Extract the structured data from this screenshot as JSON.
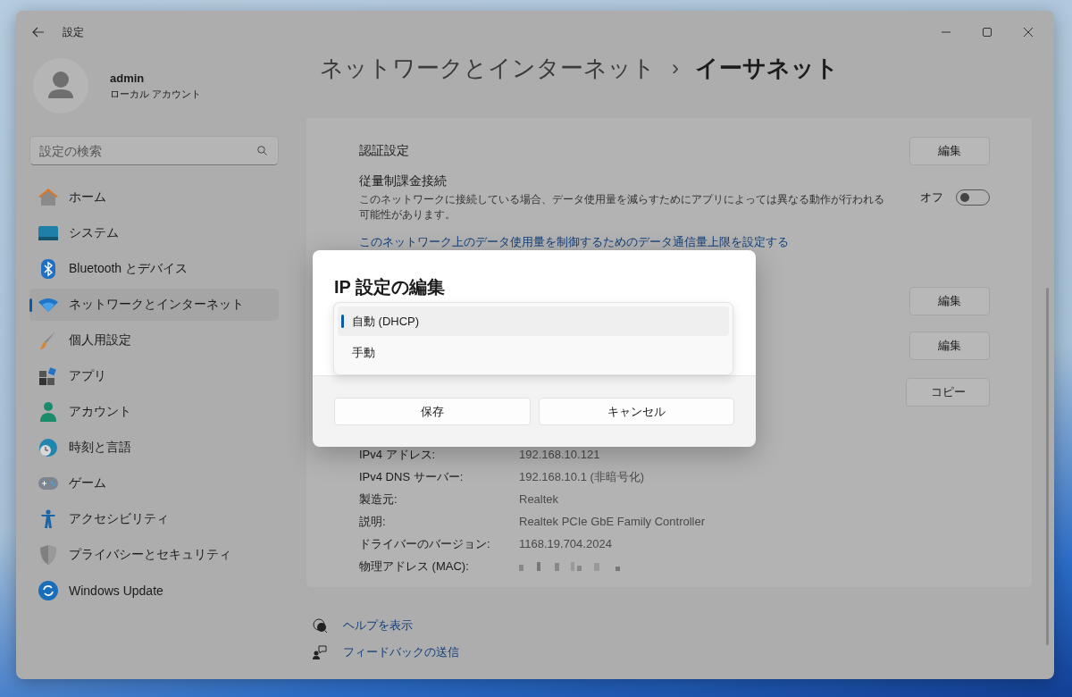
{
  "window": {
    "title": "設定"
  },
  "account": {
    "name": "admin",
    "type": "ローカル アカウント"
  },
  "search": {
    "placeholder": "設定の検索"
  },
  "sidebar": {
    "items": [
      {
        "label": "ホーム",
        "selected": false
      },
      {
        "label": "システム",
        "selected": false
      },
      {
        "label": "Bluetooth とデバイス",
        "selected": false
      },
      {
        "label": "ネットワークとインターネット",
        "selected": true
      },
      {
        "label": "個人用設定",
        "selected": false
      },
      {
        "label": "アプリ",
        "selected": false
      },
      {
        "label": "アカウント",
        "selected": false
      },
      {
        "label": "時刻と言語",
        "selected": false
      },
      {
        "label": "ゲーム",
        "selected": false
      },
      {
        "label": "アクセシビリティ",
        "selected": false
      },
      {
        "label": "プライバシーとセキュリティ",
        "selected": false
      },
      {
        "label": "Windows Update",
        "selected": false
      }
    ]
  },
  "breadcrumb": {
    "parent": "ネットワークとインターネット",
    "separator": "›",
    "current": "イーサネット"
  },
  "settings": [
    {
      "kind": "button",
      "label": "認証設定",
      "button": "編集"
    },
    {
      "kind": "toggle",
      "label": "従量制課金接続",
      "description": "このネットワークに接続している場合、データ使用量を減らすためにアプリによっては異なる動作が行われる可能性があります。",
      "state_label": "オフ",
      "on": false
    },
    {
      "kind": "link",
      "label": "このネットワーク上のデータ使用量を制御するためのデータ通信量上限を設定する"
    },
    {
      "kind": "button",
      "button": "編集"
    },
    {
      "kind": "button",
      "button": "編集"
    },
    {
      "kind": "button",
      "button": "コピー"
    }
  ],
  "properties": [
    {
      "label": "IPv4 アドレス:",
      "value": "192.168.10.121"
    },
    {
      "label": "IPv4 DNS サーバー:",
      "value": "192.168.10.1 (非暗号化)"
    },
    {
      "label": "製造元:",
      "value": "Realtek"
    },
    {
      "label": "説明:",
      "value": "Realtek PCIe GbE Family Controller"
    },
    {
      "label": "ドライバーのバージョン:",
      "value": "1168.19.704.2024"
    },
    {
      "label": "物理アドレス (MAC):",
      "redacted": true
    }
  ],
  "help_links": [
    "ヘルプを表示",
    "フィードバックの送信"
  ],
  "dialog": {
    "title": "IP 設定の編集",
    "options": [
      {
        "label": "自動 (DHCP)",
        "selected": true
      },
      {
        "label": "手動",
        "selected": false
      }
    ],
    "buttons": [
      "保存",
      "キャンセル"
    ]
  }
}
